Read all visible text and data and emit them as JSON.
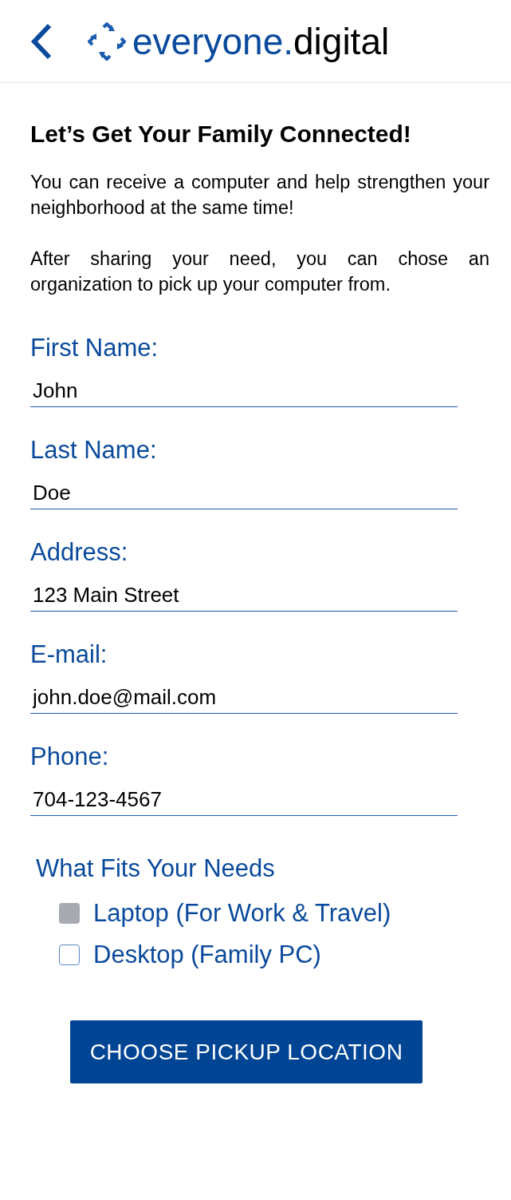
{
  "header": {
    "logo": {
      "brand": "everyone.",
      "suffix": "digital"
    }
  },
  "heading": "Let’s Get Your Family Connected!",
  "paragraphs": [
    "You can receive a computer and help strengthen your neighborhood at the same time!",
    "After sharing your need, you can chose an organization to pick up your computer from."
  ],
  "fields": [
    {
      "label": "First Name:",
      "value": "John"
    },
    {
      "label": "Last Name:",
      "value": "Doe"
    },
    {
      "label": "Address:",
      "value": "123 Main Street"
    },
    {
      "label": "E-mail:",
      "value": "john.doe@mail.com"
    },
    {
      "label": "Phone:",
      "value": "704-123-4567"
    }
  ],
  "needs": {
    "title": "What Fits Your Needs",
    "options": [
      {
        "label": "Laptop (For Work & Travel)",
        "checked": true
      },
      {
        "label": "Desktop (Family PC)",
        "checked": false
      }
    ]
  },
  "submit_button": "CHOOSE PICKUP LOCATION"
}
